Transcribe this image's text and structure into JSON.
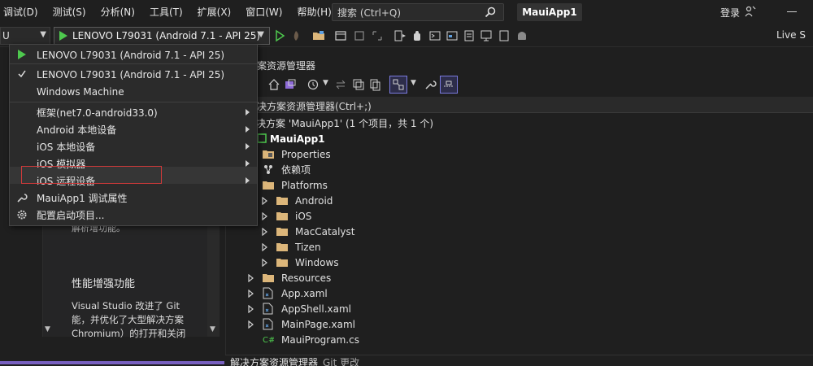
{
  "menu": [
    "调试(D)",
    "测试(S)",
    "分析(N)",
    "工具(T)",
    "扩展(X)",
    "窗口(W)",
    "帮助(H)"
  ],
  "search": {
    "placeholder": "搜索 (Ctrl+Q)"
  },
  "app_title": "MauiApp1",
  "signin_label": "登录",
  "toolbar": {
    "config_value": "U",
    "run_target": "LENOVO L79031 (Android 7.1 - API 25)",
    "live_share": "Live S"
  },
  "dropdown": {
    "items": [
      {
        "label": "LENOVO L79031 (Android 7.1 - API 25)",
        "icon": "play-icon"
      },
      {
        "label": "LENOVO L79031 (Android 7.1 - API 25)",
        "icon": "check-icon"
      },
      {
        "label": "Windows Machine",
        "icon": ""
      },
      {
        "label": "框架(net7.0-android33.0)",
        "icon": "",
        "submenu": true
      },
      {
        "label": "Android 本地设备",
        "icon": "",
        "submenu": true
      },
      {
        "label": "iOS 本地设备",
        "icon": "",
        "submenu": true
      },
      {
        "label": "iOS 模拟器",
        "icon": "",
        "submenu": true
      },
      {
        "label": "iOS 远程设备",
        "icon": "",
        "submenu": true
      },
      {
        "label": "MauiApp1 调试属性",
        "icon": "wrench-icon"
      },
      {
        "label": "配置启动项目...",
        "icon": "gear-icon"
      }
    ]
  },
  "left_panel": {
    "stub": "解析增功能。",
    "heading": "性能增强功能",
    "lines": [
      "Visual Studio 改进了 Git",
      "能，并优化了大型解决方案",
      "Chromium）的打开和关闭"
    ]
  },
  "solution_explorer": {
    "title": "案资源管理器",
    "search_placeholder": "决方案资源管理器(Ctrl+;)",
    "solution_label": "决方案 'MauiApp1' (1 个项目，共 1 个)",
    "project": "MauiApp1",
    "items": [
      {
        "label": "Properties",
        "type": "properties",
        "indent": 1,
        "expander": false
      },
      {
        "label": "依赖项",
        "type": "deps",
        "indent": 1,
        "expander": true
      },
      {
        "label": "Platforms",
        "type": "folder",
        "indent": 1,
        "expander": false,
        "open": true
      },
      {
        "label": "Android",
        "type": "folder",
        "indent": 2,
        "expander": true
      },
      {
        "label": "iOS",
        "type": "folder",
        "indent": 2,
        "expander": true
      },
      {
        "label": "MacCatalyst",
        "type": "folder",
        "indent": 2,
        "expander": true
      },
      {
        "label": "Tizen",
        "type": "folder",
        "indent": 2,
        "expander": true
      },
      {
        "label": "Windows",
        "type": "folder",
        "indent": 2,
        "expander": true
      },
      {
        "label": "Resources",
        "type": "folder",
        "indent": 1,
        "expander": true
      },
      {
        "label": "App.xaml",
        "type": "xaml",
        "indent": 1,
        "expander": true
      },
      {
        "label": "AppShell.xaml",
        "type": "xaml",
        "indent": 1,
        "expander": true
      },
      {
        "label": "MainPage.xaml",
        "type": "xaml",
        "indent": 1,
        "expander": true
      },
      {
        "label": "MauiProgram.cs",
        "type": "cs",
        "indent": 1,
        "expander": false
      }
    ],
    "tabs": [
      "解决方案资源管理器",
      "Git 更改"
    ]
  },
  "colors": {
    "accent": "#4ec94e",
    "selection_border": "#d03a3a",
    "folder": "#dcb67a",
    "purple": "#7860c0"
  }
}
